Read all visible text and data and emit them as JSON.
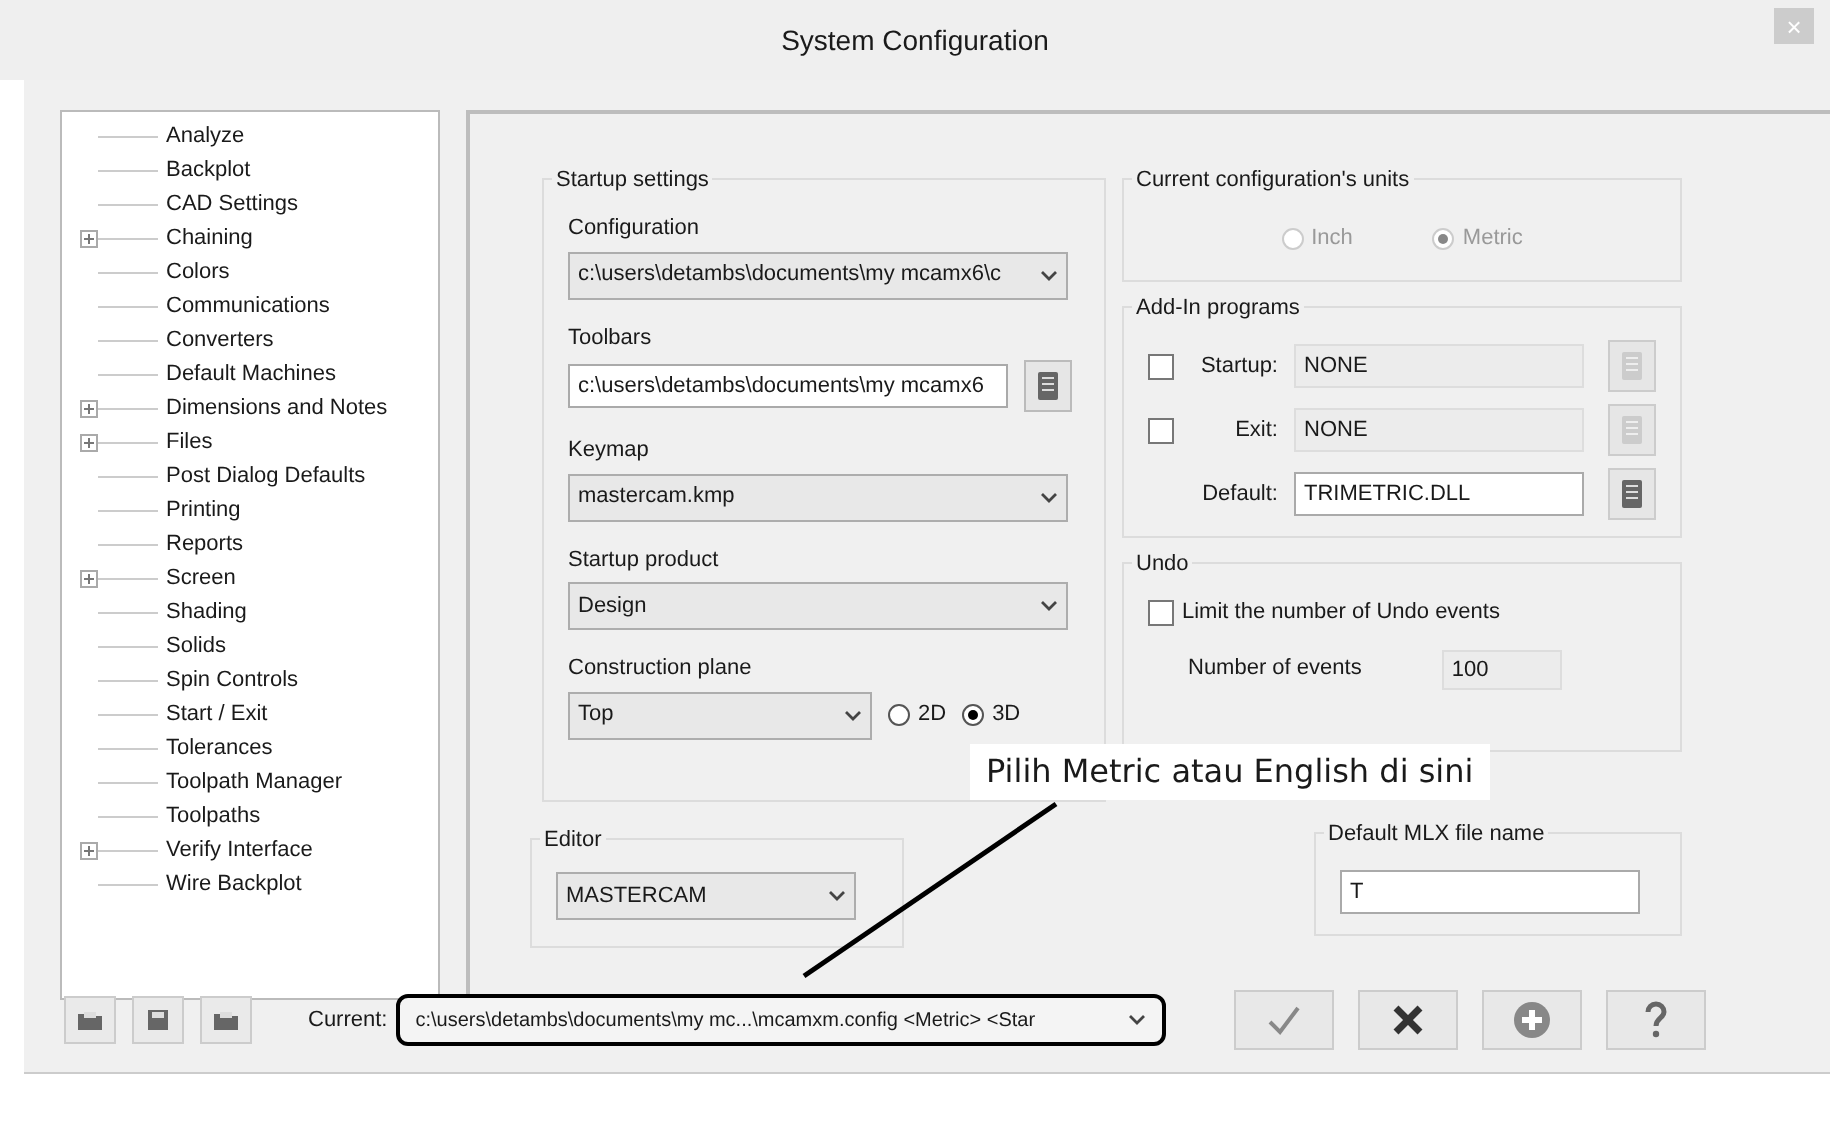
{
  "window": {
    "title": "System Configuration",
    "close": "×"
  },
  "tree": [
    {
      "label": "Analyze",
      "expandable": false
    },
    {
      "label": "Backplot",
      "expandable": false
    },
    {
      "label": "CAD Settings",
      "expandable": false
    },
    {
      "label": "Chaining",
      "expandable": true
    },
    {
      "label": "Colors",
      "expandable": false
    },
    {
      "label": "Communications",
      "expandable": false
    },
    {
      "label": "Converters",
      "expandable": false
    },
    {
      "label": "Default Machines",
      "expandable": false
    },
    {
      "label": "Dimensions and Notes",
      "expandable": true
    },
    {
      "label": "Files",
      "expandable": true
    },
    {
      "label": "Post Dialog Defaults",
      "expandable": false
    },
    {
      "label": "Printing",
      "expandable": false
    },
    {
      "label": "Reports",
      "expandable": false
    },
    {
      "label": "Screen",
      "expandable": true
    },
    {
      "label": "Shading",
      "expandable": false
    },
    {
      "label": "Solids",
      "expandable": false
    },
    {
      "label": "Spin Controls",
      "expandable": false
    },
    {
      "label": "Start / Exit",
      "expandable": false
    },
    {
      "label": "Tolerances",
      "expandable": false
    },
    {
      "label": "Toolpath Manager",
      "expandable": false
    },
    {
      "label": "Toolpaths",
      "expandable": false
    },
    {
      "label": "Verify Interface",
      "expandable": true
    },
    {
      "label": "Wire Backplot",
      "expandable": false
    }
  ],
  "startup_settings": {
    "title": "Startup settings",
    "configuration": {
      "label": "Configuration",
      "value": "c:\\users\\detambs\\documents\\my mcamx6\\c"
    },
    "toolbars": {
      "label": "Toolbars",
      "value": "c:\\users\\detambs\\documents\\my mcamx6"
    },
    "keymap": {
      "label": "Keymap",
      "value": "mastercam.kmp"
    },
    "startup_product": {
      "label": "Startup product",
      "value": "Design"
    },
    "construction_plane": {
      "label": "Construction plane",
      "value": "Top",
      "modes": [
        {
          "label": "2D",
          "selected": false
        },
        {
          "label": "3D",
          "selected": true
        }
      ]
    }
  },
  "units": {
    "title": "Current configuration's units",
    "options": [
      {
        "label": "Inch",
        "selected": false
      },
      {
        "label": "Metric",
        "selected": true
      }
    ]
  },
  "addins": {
    "title": "Add-In programs",
    "rows": [
      {
        "label": "Startup:",
        "checkbox": true,
        "checked": false,
        "value": "NONE",
        "disabled": true
      },
      {
        "label": "Exit:",
        "checkbox": true,
        "checked": false,
        "value": "NONE",
        "disabled": true
      },
      {
        "label": "Default:",
        "checkbox": false,
        "value": "TRIMETRIC.DLL",
        "disabled": false
      }
    ]
  },
  "undo": {
    "title": "Undo",
    "limit": {
      "label": "Limit the number of Undo events",
      "checked": false
    },
    "events": {
      "label": "Number of events",
      "value": "100"
    }
  },
  "editor": {
    "title": "Editor",
    "value": "MASTERCAM"
  },
  "mlx": {
    "title": "Default MLX file name",
    "value": "T"
  },
  "footer": {
    "current_label": "Current:",
    "current_value": "c:\\users\\detambs\\documents\\my mc...\\mcamxm.config <Metric> <Star"
  },
  "callout": {
    "text": "Pilih Metric atau English di sini"
  }
}
